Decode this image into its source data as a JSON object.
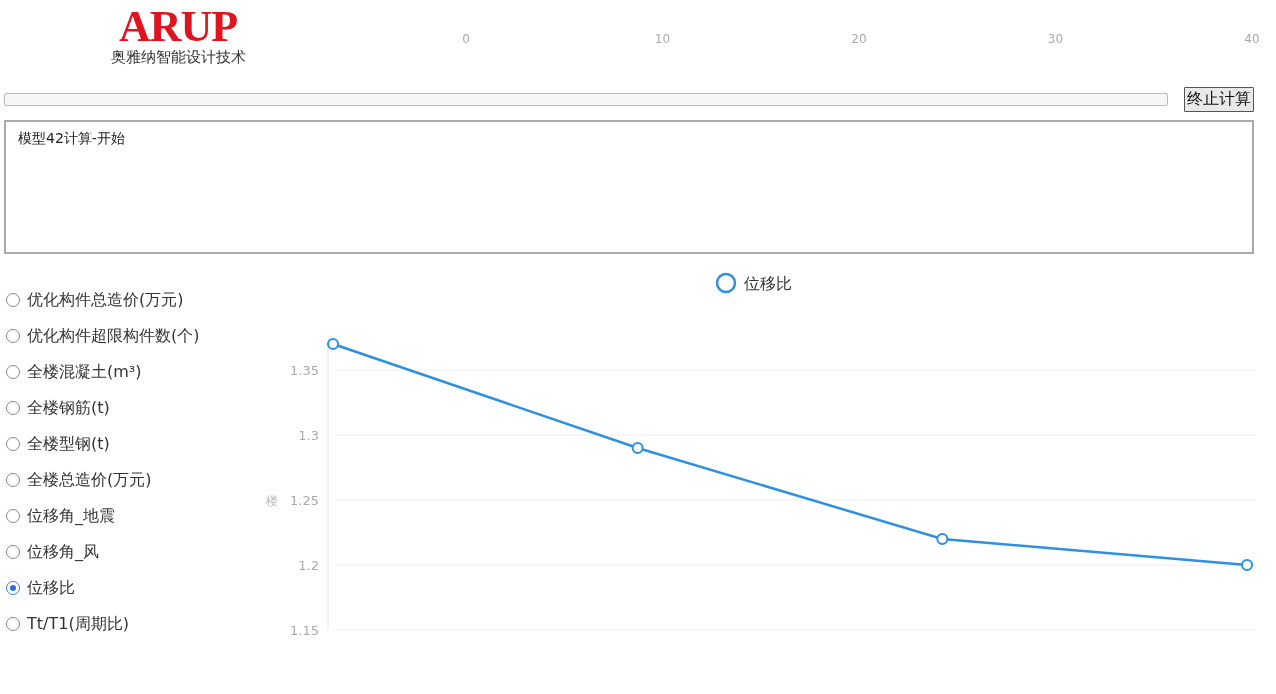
{
  "logo": {
    "brand": "ARUP",
    "subtitle": "奥雅纳智能设计技术"
  },
  "scale_ticks": [
    "0",
    "10",
    "20",
    "30",
    "40"
  ],
  "stop_button": "终止计算",
  "log": {
    "value": "模型42计算-开始"
  },
  "metrics": [
    {
      "label": "优化构件总造价(万元)",
      "selected": false
    },
    {
      "label": "优化构件超限构件数(个)",
      "selected": false
    },
    {
      "label": "全楼混凝土(m³)",
      "selected": false
    },
    {
      "label": "全楼钢筋(t)",
      "selected": false
    },
    {
      "label": "全楼型钢(t)",
      "selected": false
    },
    {
      "label": "全楼总造价(万元)",
      "selected": false
    },
    {
      "label": "位移角_地震",
      "selected": false
    },
    {
      "label": "位移角_风",
      "selected": false
    },
    {
      "label": "位移比",
      "selected": true
    },
    {
      "label": "Tt/T1(周期比)",
      "selected": false
    }
  ],
  "chart": {
    "chart_data": {
      "type": "line",
      "ylabel": "楼",
      "grid": true,
      "ylim": [
        1.15,
        1.37
      ],
      "yticks": [
        {
          "value": 1.15,
          "label": "1.15"
        },
        {
          "value": 1.2,
          "label": "1.2"
        },
        {
          "value": 1.25,
          "label": "1.25"
        },
        {
          "value": 1.3,
          "label": "1.3"
        },
        {
          "value": 1.35,
          "label": "1.35"
        }
      ],
      "series": [
        {
          "name": "位移比",
          "color": "#2f8fe0",
          "values": [
            1.37,
            1.29,
            1.22,
            1.2
          ],
          "marker": "circle"
        }
      ]
    }
  }
}
